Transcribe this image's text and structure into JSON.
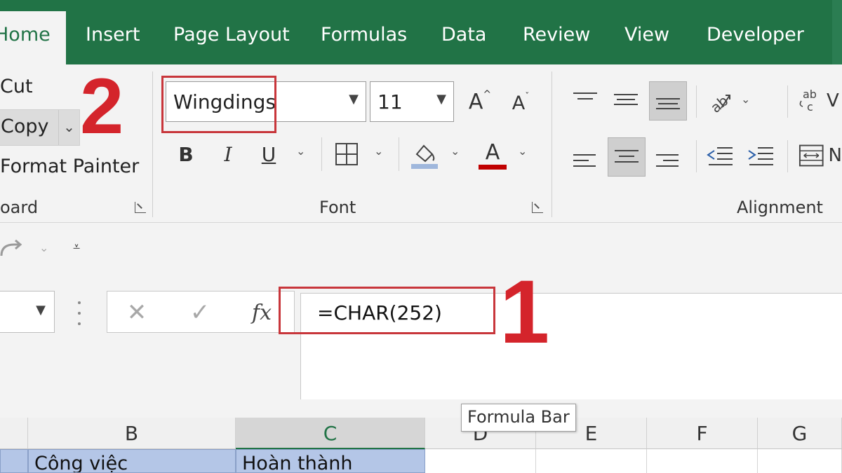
{
  "tabs": [
    "Home",
    "Insert",
    "Page Layout",
    "Formulas",
    "Data",
    "Review",
    "View",
    "Developer"
  ],
  "clipboard": {
    "cut": "Cut",
    "copy": "Copy",
    "format_painter": "Format Painter",
    "label": "oard"
  },
  "font": {
    "name": "Wingdings",
    "size": "11",
    "grow_label": "A",
    "shrink_label": "A",
    "bold": "B",
    "italic": "I",
    "underline": "U",
    "color_label": "A",
    "label": "Font"
  },
  "alignment": {
    "label": "Alignment",
    "wrap_partial": "V",
    "merge_partial": "N"
  },
  "annotations": {
    "step1": "1",
    "step2": "2"
  },
  "formula_bar": {
    "cancel": "✕",
    "enter": "✓",
    "fx": "fx",
    "formula": "=CHAR(252)",
    "tooltip": "Formula Bar"
  },
  "grid": {
    "columns": [
      "B",
      "C",
      "D",
      "E",
      "F",
      "G"
    ],
    "row_cells": [
      "Công việc",
      "Hoàn thành"
    ]
  },
  "colors": {
    "ribbon_green": "#217346",
    "annotation_red": "#d4242b",
    "font_color_bar": "#c00000",
    "fill_color_bar": "#9fb7dc",
    "highlight_cell": "#b4c6e7"
  }
}
